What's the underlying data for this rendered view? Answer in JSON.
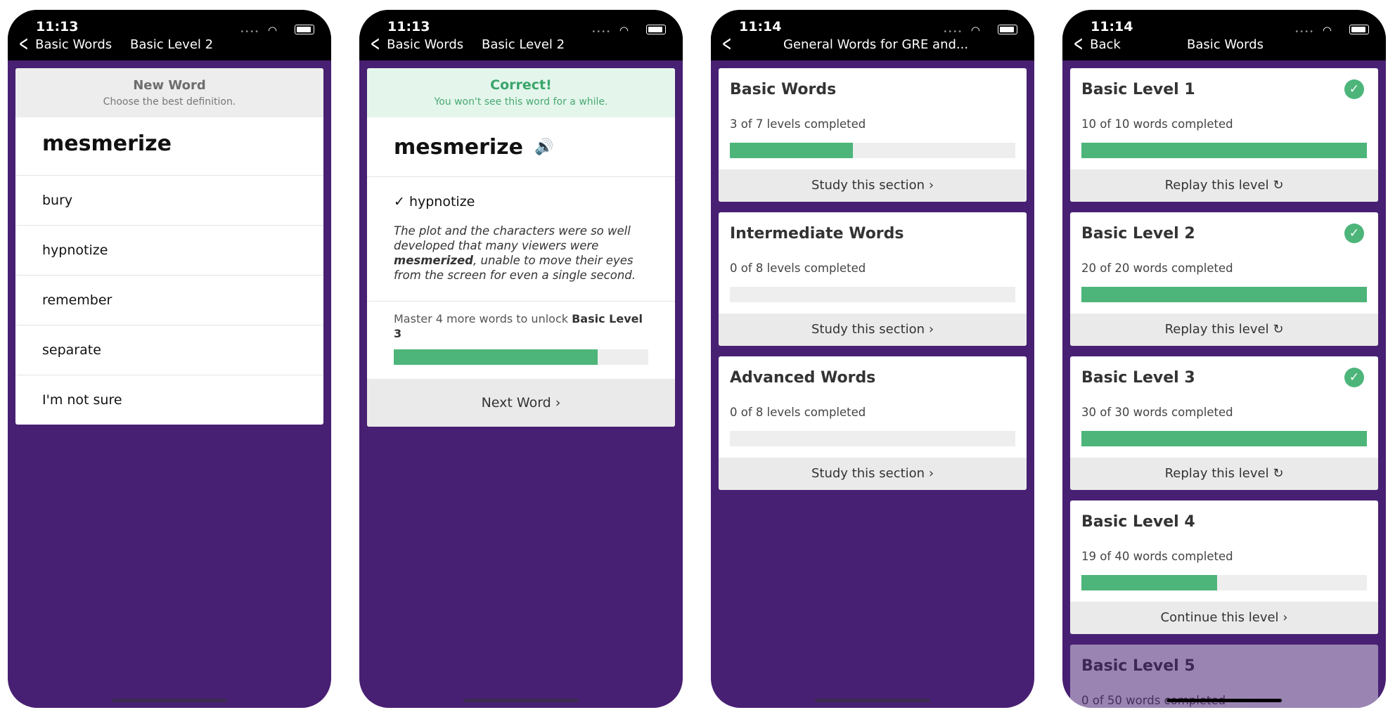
{
  "phones": [
    {
      "time": "11:13",
      "back_label": "Basic Words",
      "title": "Basic Level 2",
      "question": {
        "header_title": "New Word",
        "header_subtitle": "Choose the best definition.",
        "word": "mesmerize",
        "options": [
          "bury",
          "hypnotize",
          "remember",
          "separate",
          "I'm not sure"
        ]
      }
    },
    {
      "time": "11:13",
      "back_label": "Basic Words",
      "title": "Basic Level 2",
      "result": {
        "header_title": "Correct!",
        "header_subtitle": "You won't see this word for a while.",
        "word": "mesmerize",
        "speaker_icon": "speaker-icon",
        "answer": "✓ hypnotize",
        "example_before": "The plot and the characters were so well developed that many viewers were ",
        "example_bold": "mesmerized",
        "example_after": ", unable to move their eyes from the screen for even a single second.",
        "unlock_text": "Master 4 more words to unlock ",
        "unlock_bold": "Basic Level 3",
        "progress": 0.8,
        "next_label": "Next Word"
      }
    },
    {
      "time": "11:14",
      "back_label": "",
      "title": "General Words for GRE and...",
      "sections": [
        {
          "title": "Basic Words",
          "subtitle": "3 of 7 levels completed",
          "progress": 0.43,
          "action": "Study this section"
        },
        {
          "title": "Intermediate Words",
          "subtitle": "0 of 8 levels completed",
          "progress": 0,
          "action": "Study this section"
        },
        {
          "title": "Advanced Words",
          "subtitle": "0 of 8 levels completed",
          "progress": 0,
          "action": "Study this section"
        }
      ]
    },
    {
      "time": "11:14",
      "back_label": "Back",
      "title": "Basic Words",
      "levels": [
        {
          "title": "Basic Level 1",
          "subtitle": "10 of 10 words completed",
          "progress": 1.0,
          "action": "Replay this level",
          "action_icon": "↻",
          "completed": true
        },
        {
          "title": "Basic Level 2",
          "subtitle": "20 of 20 words completed",
          "progress": 1.0,
          "action": "Replay this level",
          "action_icon": "↻",
          "completed": true
        },
        {
          "title": "Basic Level 3",
          "subtitle": "30 of 30 words completed",
          "progress": 1.0,
          "action": "Replay this level",
          "action_icon": "↻",
          "completed": true
        },
        {
          "title": "Basic Level 4",
          "subtitle": "19 of 40 words completed",
          "progress": 0.475,
          "action": "Continue this level",
          "action_icon": "›",
          "completed": false
        },
        {
          "title": "Basic Level 5",
          "subtitle": "0 of 50 words completed",
          "progress": 0,
          "action": "",
          "action_icon": "",
          "completed": false
        }
      ]
    }
  ],
  "colors": {
    "purple": "#482073",
    "green": "#4db57a",
    "correct_bg": "#e4f6ec"
  }
}
